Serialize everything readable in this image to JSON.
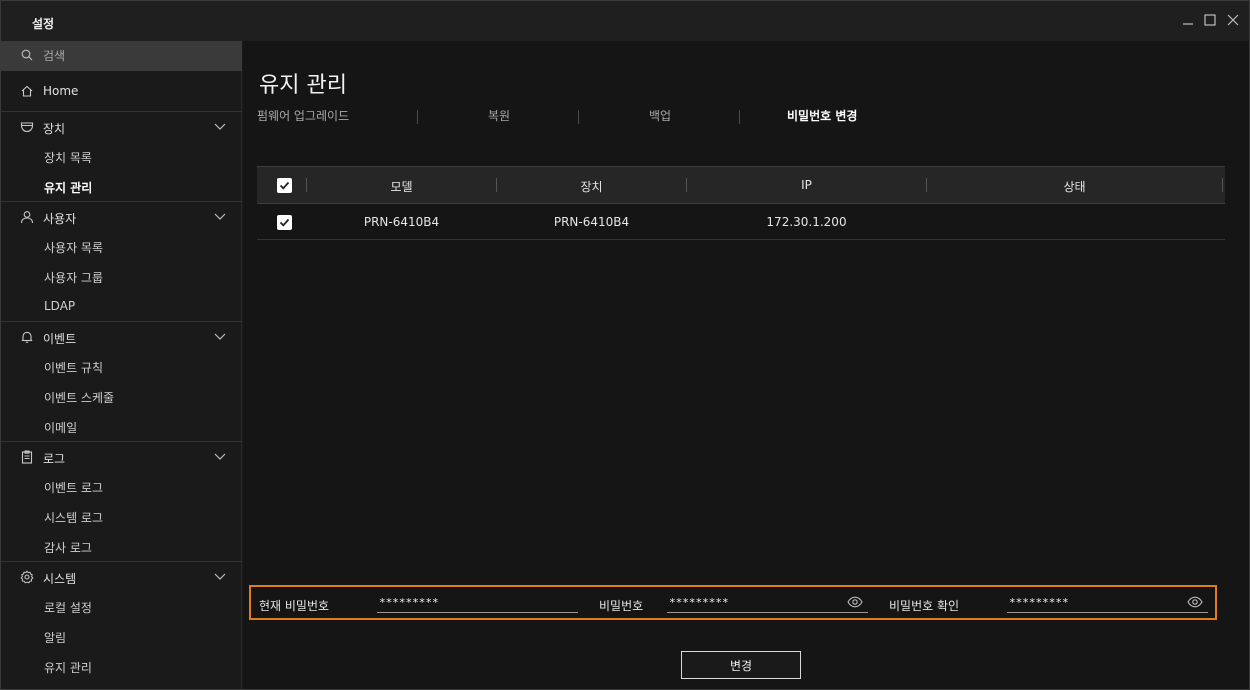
{
  "window": {
    "title": "설정"
  },
  "sidebar": {
    "search_placeholder": "검색",
    "home": {
      "label": "Home",
      "icon": "home-icon"
    },
    "groups": [
      {
        "label": "장치",
        "icon": "device-icon",
        "items": [
          "장치 목록",
          "유지 관리"
        ]
      },
      {
        "label": "사용자",
        "icon": "user-icon",
        "items": [
          "사용자 목록",
          "사용자 그룹",
          "LDAP"
        ]
      },
      {
        "label": "이벤트",
        "icon": "bell-icon",
        "items": [
          "이벤트 규칙",
          "이벤트 스케줄",
          "이메일"
        ]
      },
      {
        "label": "로그",
        "icon": "clipboard-icon",
        "items": [
          "이벤트 로그",
          "시스템 로그",
          "감사 로그"
        ]
      },
      {
        "label": "시스템",
        "icon": "gear-icon",
        "items": [
          "로컬 설정",
          "알림",
          "유지 관리"
        ]
      }
    ],
    "active_item": "장치.유지 관리"
  },
  "main": {
    "title": "유지 관리",
    "tabs": [
      "펌웨어 업그레이드",
      "복원",
      "백업",
      "비밀번호 변경"
    ],
    "active_tab": "비밀번호 변경",
    "table": {
      "columns": [
        "모델",
        "장치",
        "IP",
        "상태"
      ],
      "rows": [
        {
          "checked": true,
          "model": "PRN-6410B4",
          "device": "PRN-6410B4",
          "ip": "172.30.1.200",
          "status": ""
        }
      ],
      "header_checked": true
    },
    "password": {
      "current_label": "현재 비밀번호",
      "current_value": "*********",
      "new_label": "비밀번호",
      "new_value": "*********",
      "confirm_label": "비밀번호 확인",
      "confirm_value": "*********"
    },
    "apply_label": "변경"
  },
  "colors": {
    "accent_outline": "#e07b1e",
    "background": "#151515",
    "sidebar": "#1a1a1a",
    "search_bg": "#3a3a3a"
  }
}
